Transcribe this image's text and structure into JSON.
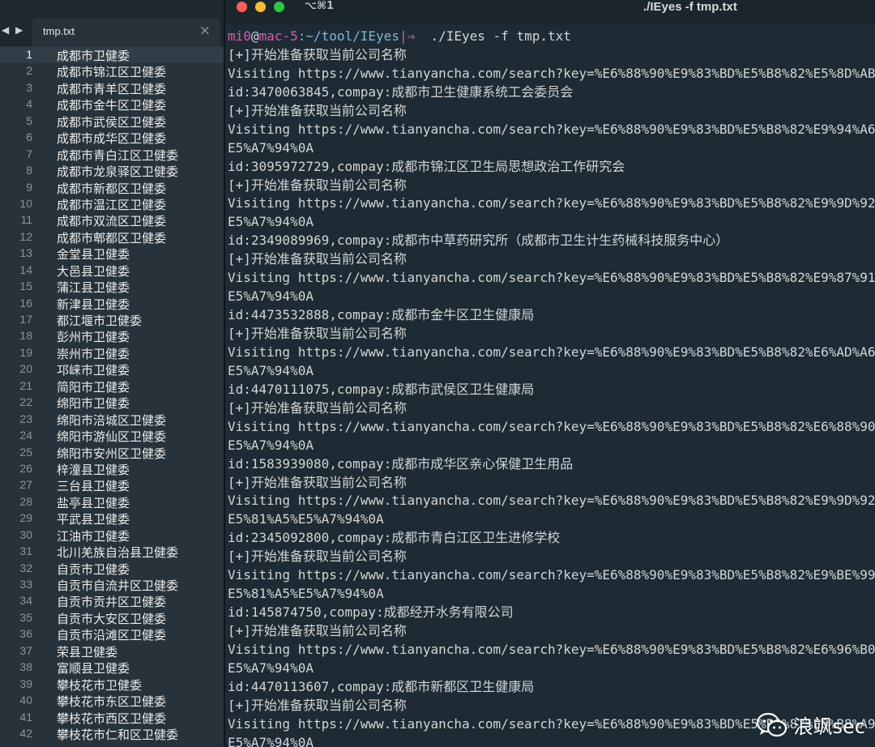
{
  "editor": {
    "nav_arrows": "◀ ▶",
    "tab": {
      "label": "tmp.txt",
      "close": "×"
    },
    "current_line": 1,
    "lines": [
      "成都市卫健委",
      "成都市锦江区卫健委",
      "成都市青羊区卫健委",
      "成都市金牛区卫健委",
      "成都市武侯区卫健委",
      "成都市成华区卫健委",
      "成都市青白江区卫健委",
      "成都市龙泉驿区卫健委",
      "成都市新都区卫健委",
      "成都市温江区卫健委",
      "成都市双流区卫健委",
      "成都市郫都区卫健委",
      "金堂县卫健委",
      "大邑县卫健委",
      "蒲江县卫健委",
      "新津县卫健委",
      "都江堰市卫健委",
      "彭州市卫健委",
      "崇州市卫健委",
      "邛崃市卫健委",
      "简阳市卫健委",
      "绵阳市卫健委",
      "绵阳市涪城区卫健委",
      "绵阳市游仙区卫健委",
      "绵阳市安州区卫健委",
      "梓潼县卫健委",
      "三台县卫健委",
      "盐亭县卫健委",
      "平武县卫健委",
      "江油市卫健委",
      "北川羌族自治县卫健委",
      "自贡市卫健委",
      "自贡市自流井区卫健委",
      "自贡市贡井区卫健委",
      "自贡市大安区卫健委",
      "自贡市沿滩区卫健委",
      "荣县卫健委",
      "富顺县卫健委",
      "攀枝花市卫健委",
      "攀枝花市东区卫健委",
      "攀枝花市西区卫健委",
      "攀枝花市仁和区卫健委"
    ]
  },
  "terminal": {
    "shortcut": "⌥⌘1",
    "window_title": "./IEyes -f tmp.txt",
    "prompt": {
      "user": "mi0",
      "at": "@",
      "host": "mac-5",
      "path": ":~/tool/IEyes",
      "branch_marker": "|⇒",
      "command": "  ./IEyes -f tmp.txt"
    },
    "output": [
      "[+]开始准备获取当前公司名称",
      "Visiting https://www.tianyancha.com/search?key=%E6%88%90%E9%83%BD%E5%B8%82%E5%8D%AB",
      "id:3470063845,compay:成都市卫生健康系统工会委员会",
      "[+]开始准备获取当前公司名称",
      "Visiting https://www.tianyancha.com/search?key=%E6%88%90%E9%83%BD%E5%B8%82%E9%94%A6",
      "E5%A7%94%0A",
      "id:3095972729,compay:成都市锦江区卫生局思想政治工作研究会",
      "[+]开始准备获取当前公司名称",
      "Visiting https://www.tianyancha.com/search?key=%E6%88%90%E9%83%BD%E5%B8%82%E9%9D%92",
      "E5%A7%94%0A",
      "id:2349089969,compay:成都市中草药研究所（成都市卫生计生药械科技服务中心）",
      "[+]开始准备获取当前公司名称",
      "Visiting https://www.tianyancha.com/search?key=%E6%88%90%E9%83%BD%E5%B8%82%E9%87%91",
      "E5%A7%94%0A",
      "id:4473532888,compay:成都市金牛区卫生健康局",
      "[+]开始准备获取当前公司名称",
      "Visiting https://www.tianyancha.com/search?key=%E6%88%90%E9%83%BD%E5%B8%82%E6%AD%A6",
      "E5%A7%94%0A",
      "id:4470111075,compay:成都市武侯区卫生健康局",
      "[+]开始准备获取当前公司名称",
      "Visiting https://www.tianyancha.com/search?key=%E6%88%90%E9%83%BD%E5%B8%82%E6%88%90",
      "E5%A7%94%0A",
      "id:1583939080,compay:成都市成华区亲心保健卫生用品",
      "[+]开始准备获取当前公司名称",
      "Visiting https://www.tianyancha.com/search?key=%E6%88%90%E9%83%BD%E5%B8%82%E9%9D%92",
      "E5%81%A5%E5%A7%94%0A",
      "id:2345092800,compay:成都市青白江区卫生进修学校",
      "[+]开始准备获取当前公司名称",
      "Visiting https://www.tianyancha.com/search?key=%E6%88%90%E9%83%BD%E5%B8%82%E9%BE%99",
      "E5%81%A5%E5%A7%94%0A",
      "id:145874750,compay:成都经开水务有限公司",
      "[+]开始准备获取当前公司名称",
      "Visiting https://www.tianyancha.com/search?key=%E6%88%90%E9%83%BD%E5%B8%82%E6%96%B0",
      "E5%A7%94%0A",
      "id:4470113607,compay:成都市新都区卫生健康局",
      "[+]开始准备获取当前公司名称",
      "Visiting https://www.tianyancha.com/search?key=%E6%88%90%E9%83%BD%E5%B8%82%E6%B8%A9",
      "E5%A7%94%0A"
    ]
  },
  "watermark": {
    "icon": "wechat-icon",
    "text": "浪飒sec"
  },
  "colors": {
    "terminal_bg": "#1e2b34",
    "editor_bg": "#27323a",
    "prompt_pink": "#d65ea4",
    "prompt_path": "#7fb7d8"
  }
}
